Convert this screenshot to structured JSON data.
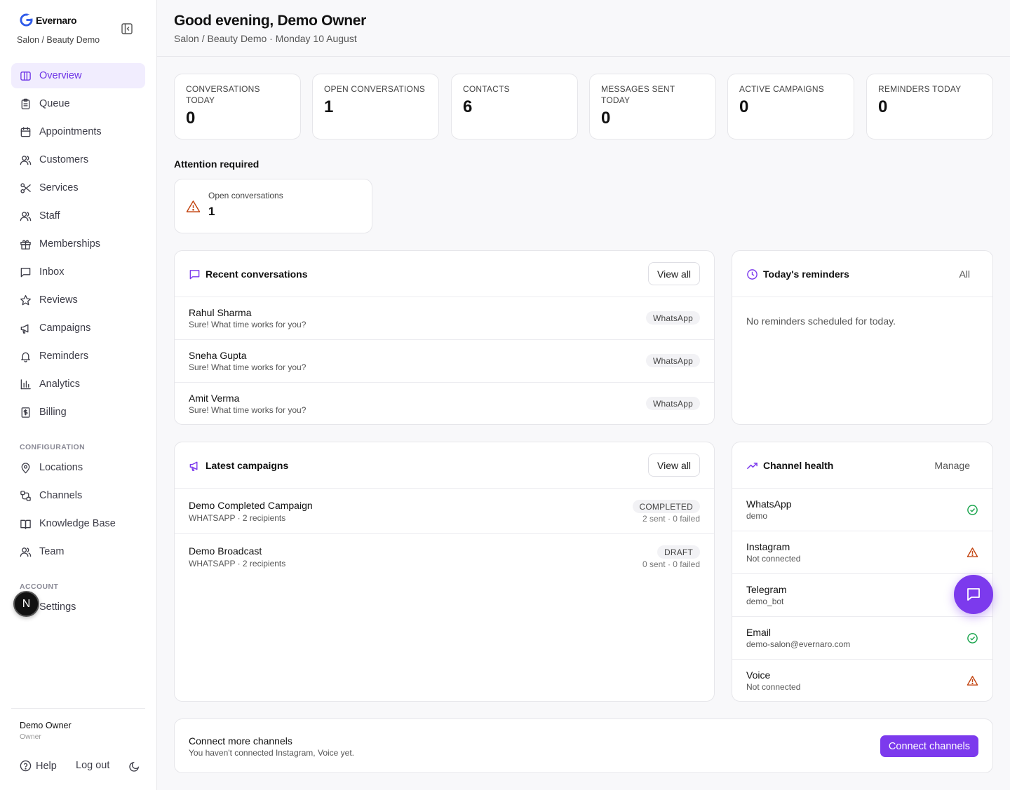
{
  "brand": {
    "name": "Evernaro",
    "subtitle": "Salon / Beauty Demo"
  },
  "nav": {
    "main": [
      {
        "label": "Overview",
        "icon": "overview-icon",
        "active": true
      },
      {
        "label": "Queue",
        "icon": "clipboard-icon"
      },
      {
        "label": "Appointments",
        "icon": "calendar-icon"
      },
      {
        "label": "Customers",
        "icon": "users-icon"
      },
      {
        "label": "Services",
        "icon": "scissors-icon"
      },
      {
        "label": "Staff",
        "icon": "users-icon"
      },
      {
        "label": "Memberships",
        "icon": "gift-icon"
      },
      {
        "label": "Inbox",
        "icon": "message-square-icon"
      },
      {
        "label": "Reviews",
        "icon": "star-icon"
      },
      {
        "label": "Campaigns",
        "icon": "megaphone-icon"
      },
      {
        "label": "Reminders",
        "icon": "bell-icon"
      },
      {
        "label": "Analytics",
        "icon": "bar-chart-icon"
      },
      {
        "label": "Billing",
        "icon": "receipt-icon"
      }
    ],
    "configuration_label": "CONFIGURATION",
    "configuration": [
      {
        "label": "Locations",
        "icon": "map-pin-icon"
      },
      {
        "label": "Channels",
        "icon": "workflow-icon"
      },
      {
        "label": "Knowledge Base",
        "icon": "book-icon"
      },
      {
        "label": "Team",
        "icon": "users-icon"
      }
    ],
    "account_label": "ACCOUNT",
    "account": [
      {
        "label": "Settings",
        "icon": "gear-icon"
      }
    ]
  },
  "user": {
    "name": "Demo Owner",
    "role": "Owner",
    "avatar_letter": "N"
  },
  "footer": {
    "help": "Help",
    "logout": "Log out"
  },
  "header": {
    "greeting": "Good evening, Demo Owner",
    "subline": "Salon / Beauty Demo · Monday 10 August"
  },
  "stats": [
    {
      "label": "CONVERSATIONS TODAY",
      "value": "0"
    },
    {
      "label": "OPEN CONVERSATIONS",
      "value": "1"
    },
    {
      "label": "CONTACTS",
      "value": "6"
    },
    {
      "label": "MESSAGES SENT TODAY",
      "value": "0"
    },
    {
      "label": "ACTIVE CAMPAIGNS",
      "value": "0"
    },
    {
      "label": "REMINDERS TODAY",
      "value": "0"
    }
  ],
  "attention": {
    "title": "Attention required",
    "label": "Open conversations",
    "value": "1"
  },
  "recent_conversations": {
    "title": "Recent conversations",
    "action": "View all",
    "items": [
      {
        "name": "Rahul Sharma",
        "preview": "Sure! What time works for you?",
        "channel": "WhatsApp"
      },
      {
        "name": "Sneha Gupta",
        "preview": "Sure! What time works for you?",
        "channel": "WhatsApp"
      },
      {
        "name": "Amit Verma",
        "preview": "Sure! What time works for you?",
        "channel": "WhatsApp"
      }
    ]
  },
  "reminders": {
    "title": "Today's reminders",
    "action": "All",
    "empty": "No reminders scheduled for today."
  },
  "campaigns": {
    "title": "Latest campaigns",
    "action": "View all",
    "items": [
      {
        "name": "Demo Completed Campaign",
        "detail": "WHATSAPP · 2 recipients",
        "status": "COMPLETED",
        "stats": "2 sent · 0 failed"
      },
      {
        "name": "Demo Broadcast",
        "detail": "WHATSAPP · 2 recipients",
        "status": "DRAFT",
        "stats": "0 sent · 0 failed"
      }
    ]
  },
  "channel_health": {
    "title": "Channel health",
    "action": "Manage",
    "items": [
      {
        "name": "WhatsApp",
        "detail": "demo",
        "status": "ok"
      },
      {
        "name": "Instagram",
        "detail": "Not connected",
        "status": "warning"
      },
      {
        "name": "Telegram",
        "detail": "demo_bot",
        "status": "ok"
      },
      {
        "name": "Email",
        "detail": "demo-salon@evernaro.com",
        "status": "ok"
      },
      {
        "name": "Voice",
        "detail": "Not connected",
        "status": "warning"
      }
    ]
  },
  "connect": {
    "title": "Connect more channels",
    "subtitle": "You haven't connected Instagram, Voice yet.",
    "button": "Connect channels"
  },
  "colors": {
    "accent": "#7c3aed",
    "ok": "#16a34a",
    "warning": "#c2410c"
  }
}
